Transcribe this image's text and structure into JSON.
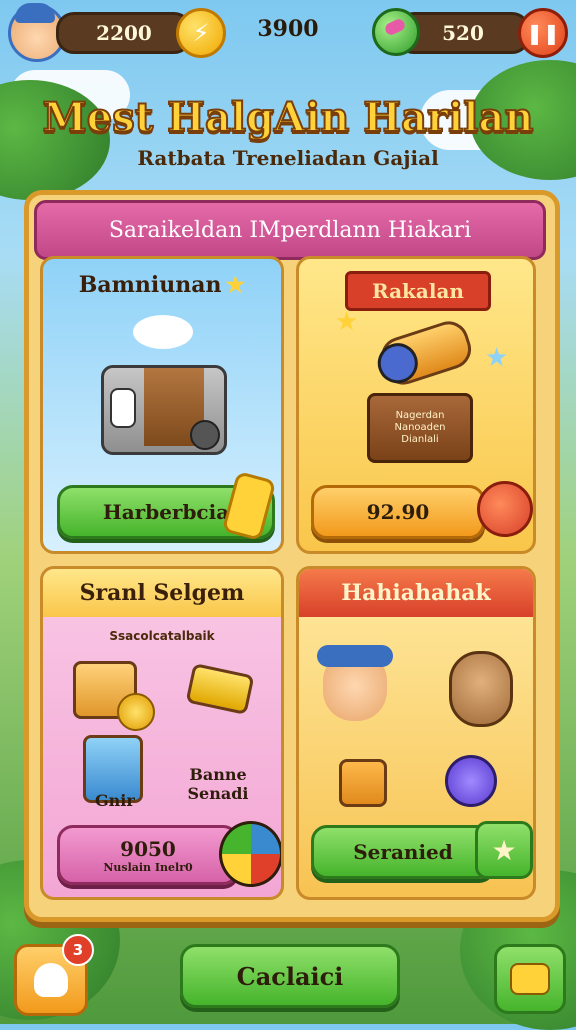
{
  "hud": {
    "coins": "2200",
    "score": "3900",
    "gems": "520"
  },
  "header": {
    "title": "Mest HalgAin Harilan",
    "subtitle": "Ratbata Treneliadan Gajial"
  },
  "panel": {
    "banner": "Saraikeldan IMperdlann Hiakari"
  },
  "cards": [
    {
      "title": "Bamniunan",
      "button": "Harberbcia"
    },
    {
      "title": "Rakalan",
      "price": "92.90",
      "crate_text": "Nagerdan Nanoaden Dianlali"
    },
    {
      "title": "Sranl Selgem",
      "subtitle": "Ssacolcatalbaik",
      "item_text_1": "Gnir",
      "item_text_2": "Banne Senadi",
      "price": "9050",
      "price_sub": "Nuslain Inelr0"
    },
    {
      "title": "Hahiahahak",
      "button": "Seranied"
    }
  ],
  "footer": {
    "notification_count": "3",
    "main_button": "Caclaici"
  },
  "colors": {
    "accent_pink": "#c24787",
    "accent_green": "#46b42c",
    "accent_orange": "#f29a1c",
    "board": "#f6d27a"
  },
  "icons": [
    "avatar",
    "lightning-coin-icon",
    "gem-icon",
    "pause-icon",
    "chest-icon",
    "cannon-icon",
    "notification-icon",
    "shop-icon"
  ]
}
